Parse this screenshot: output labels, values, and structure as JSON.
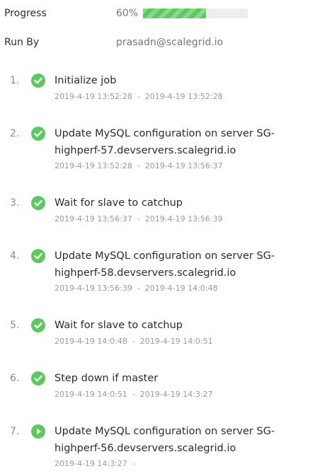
{
  "progress": {
    "label": "Progress",
    "percent_text": "60%",
    "fraction": 0.6,
    "color": "#5bc95e"
  },
  "run_by": {
    "label": "Run By",
    "value": "prasadn@scalegrid.io"
  },
  "steps": [
    {
      "number": "1.",
      "status": "done",
      "icon": "check-circle-icon",
      "title_line1": "Initialize job",
      "title_line2": "",
      "time": "2019-4-19 13:52:28  -  2019-4-19 13:52:28"
    },
    {
      "number": "2.",
      "status": "done",
      "icon": "check-circle-icon",
      "title_line1": "Update MySQL configuration on server SG-",
      "title_line2": "highperf-57.devservers.scalegrid.io",
      "time": "2019-4-19 13:52:28  -  2019-4-19 13:56:37"
    },
    {
      "number": "3.",
      "status": "done",
      "icon": "check-circle-icon",
      "title_line1": "Wait for slave to catchup",
      "title_line2": "",
      "time": "2019-4-19 13:56:37  -  2019-4-19 13:56:39"
    },
    {
      "number": "4.",
      "status": "done",
      "icon": "check-circle-icon",
      "title_line1": "Update MySQL configuration on server SG-",
      "title_line2": "highperf-58.devservers.scalegrid.io",
      "time": "2019-4-19 13:56:39  -  2019-4-19 14:0:48"
    },
    {
      "number": "5.",
      "status": "done",
      "icon": "check-circle-icon",
      "title_line1": "Wait for slave to catchup",
      "title_line2": "",
      "time": "2019-4-19 14:0:48  -  2019-4-19 14:0:51"
    },
    {
      "number": "6.",
      "status": "done",
      "icon": "check-circle-icon",
      "title_line1": "Step down if master",
      "title_line2": "",
      "time": "2019-4-19 14:0:51  -  2019-4-19 14:3:27"
    },
    {
      "number": "7.",
      "status": "running",
      "icon": "play-circle-icon",
      "title_line1": "Update MySQL configuration on server SG-",
      "title_line2": "highperf-56.devservers.scalegrid.io",
      "time": "2019-4-19 14:3:27  -"
    }
  ]
}
